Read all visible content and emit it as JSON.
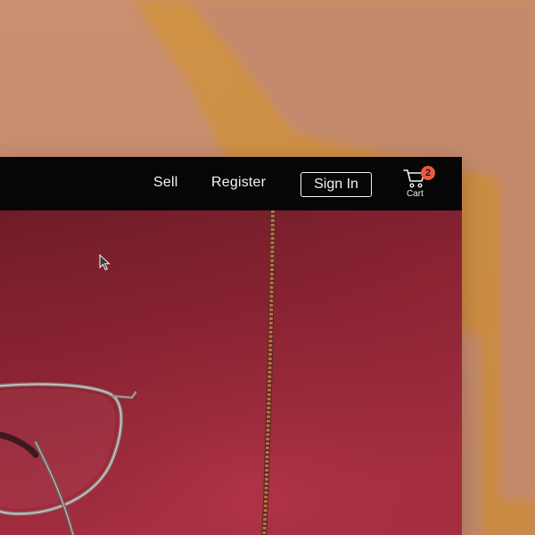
{
  "nav": {
    "sell_label": "Sell",
    "register_label": "Register",
    "sign_in_label": "Sign In"
  },
  "cart": {
    "label": "Cart",
    "count": "2",
    "icon": "cart-icon"
  },
  "colors": {
    "navbar_bg": "#060606",
    "badge": "#ef5a3c",
    "hero_bg": "#a3283c",
    "backdrop_peach": "#c38a6c",
    "backdrop_orange": "#cf8e45"
  },
  "hero": {
    "image": "red backdrop with eyeglasses and a hanging chain"
  }
}
